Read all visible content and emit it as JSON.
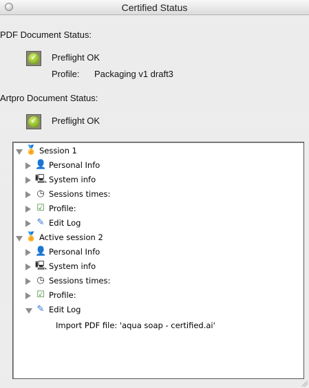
{
  "window": {
    "title": "Certified Status"
  },
  "pdf_status": {
    "heading": "PDF Document Status:",
    "status": "Preflight OK",
    "profile_label": "Profile:",
    "profile_value": "Packaging v1 draft3"
  },
  "artpro_status": {
    "heading": "Artpro Document Status:",
    "status": "Preflight OK"
  },
  "tree": {
    "session1": {
      "label": "Session 1",
      "children": [
        "Personal Info",
        "System info",
        "Sessions times:",
        "Profile:",
        "Edit Log"
      ]
    },
    "session2": {
      "label": "Active session 2",
      "children": [
        "Personal Info",
        "System info",
        "Sessions times:",
        "Profile:",
        "Edit Log"
      ],
      "edit_log_entry": "Import PDF file: 'aqua soap - certified.ai'"
    }
  }
}
